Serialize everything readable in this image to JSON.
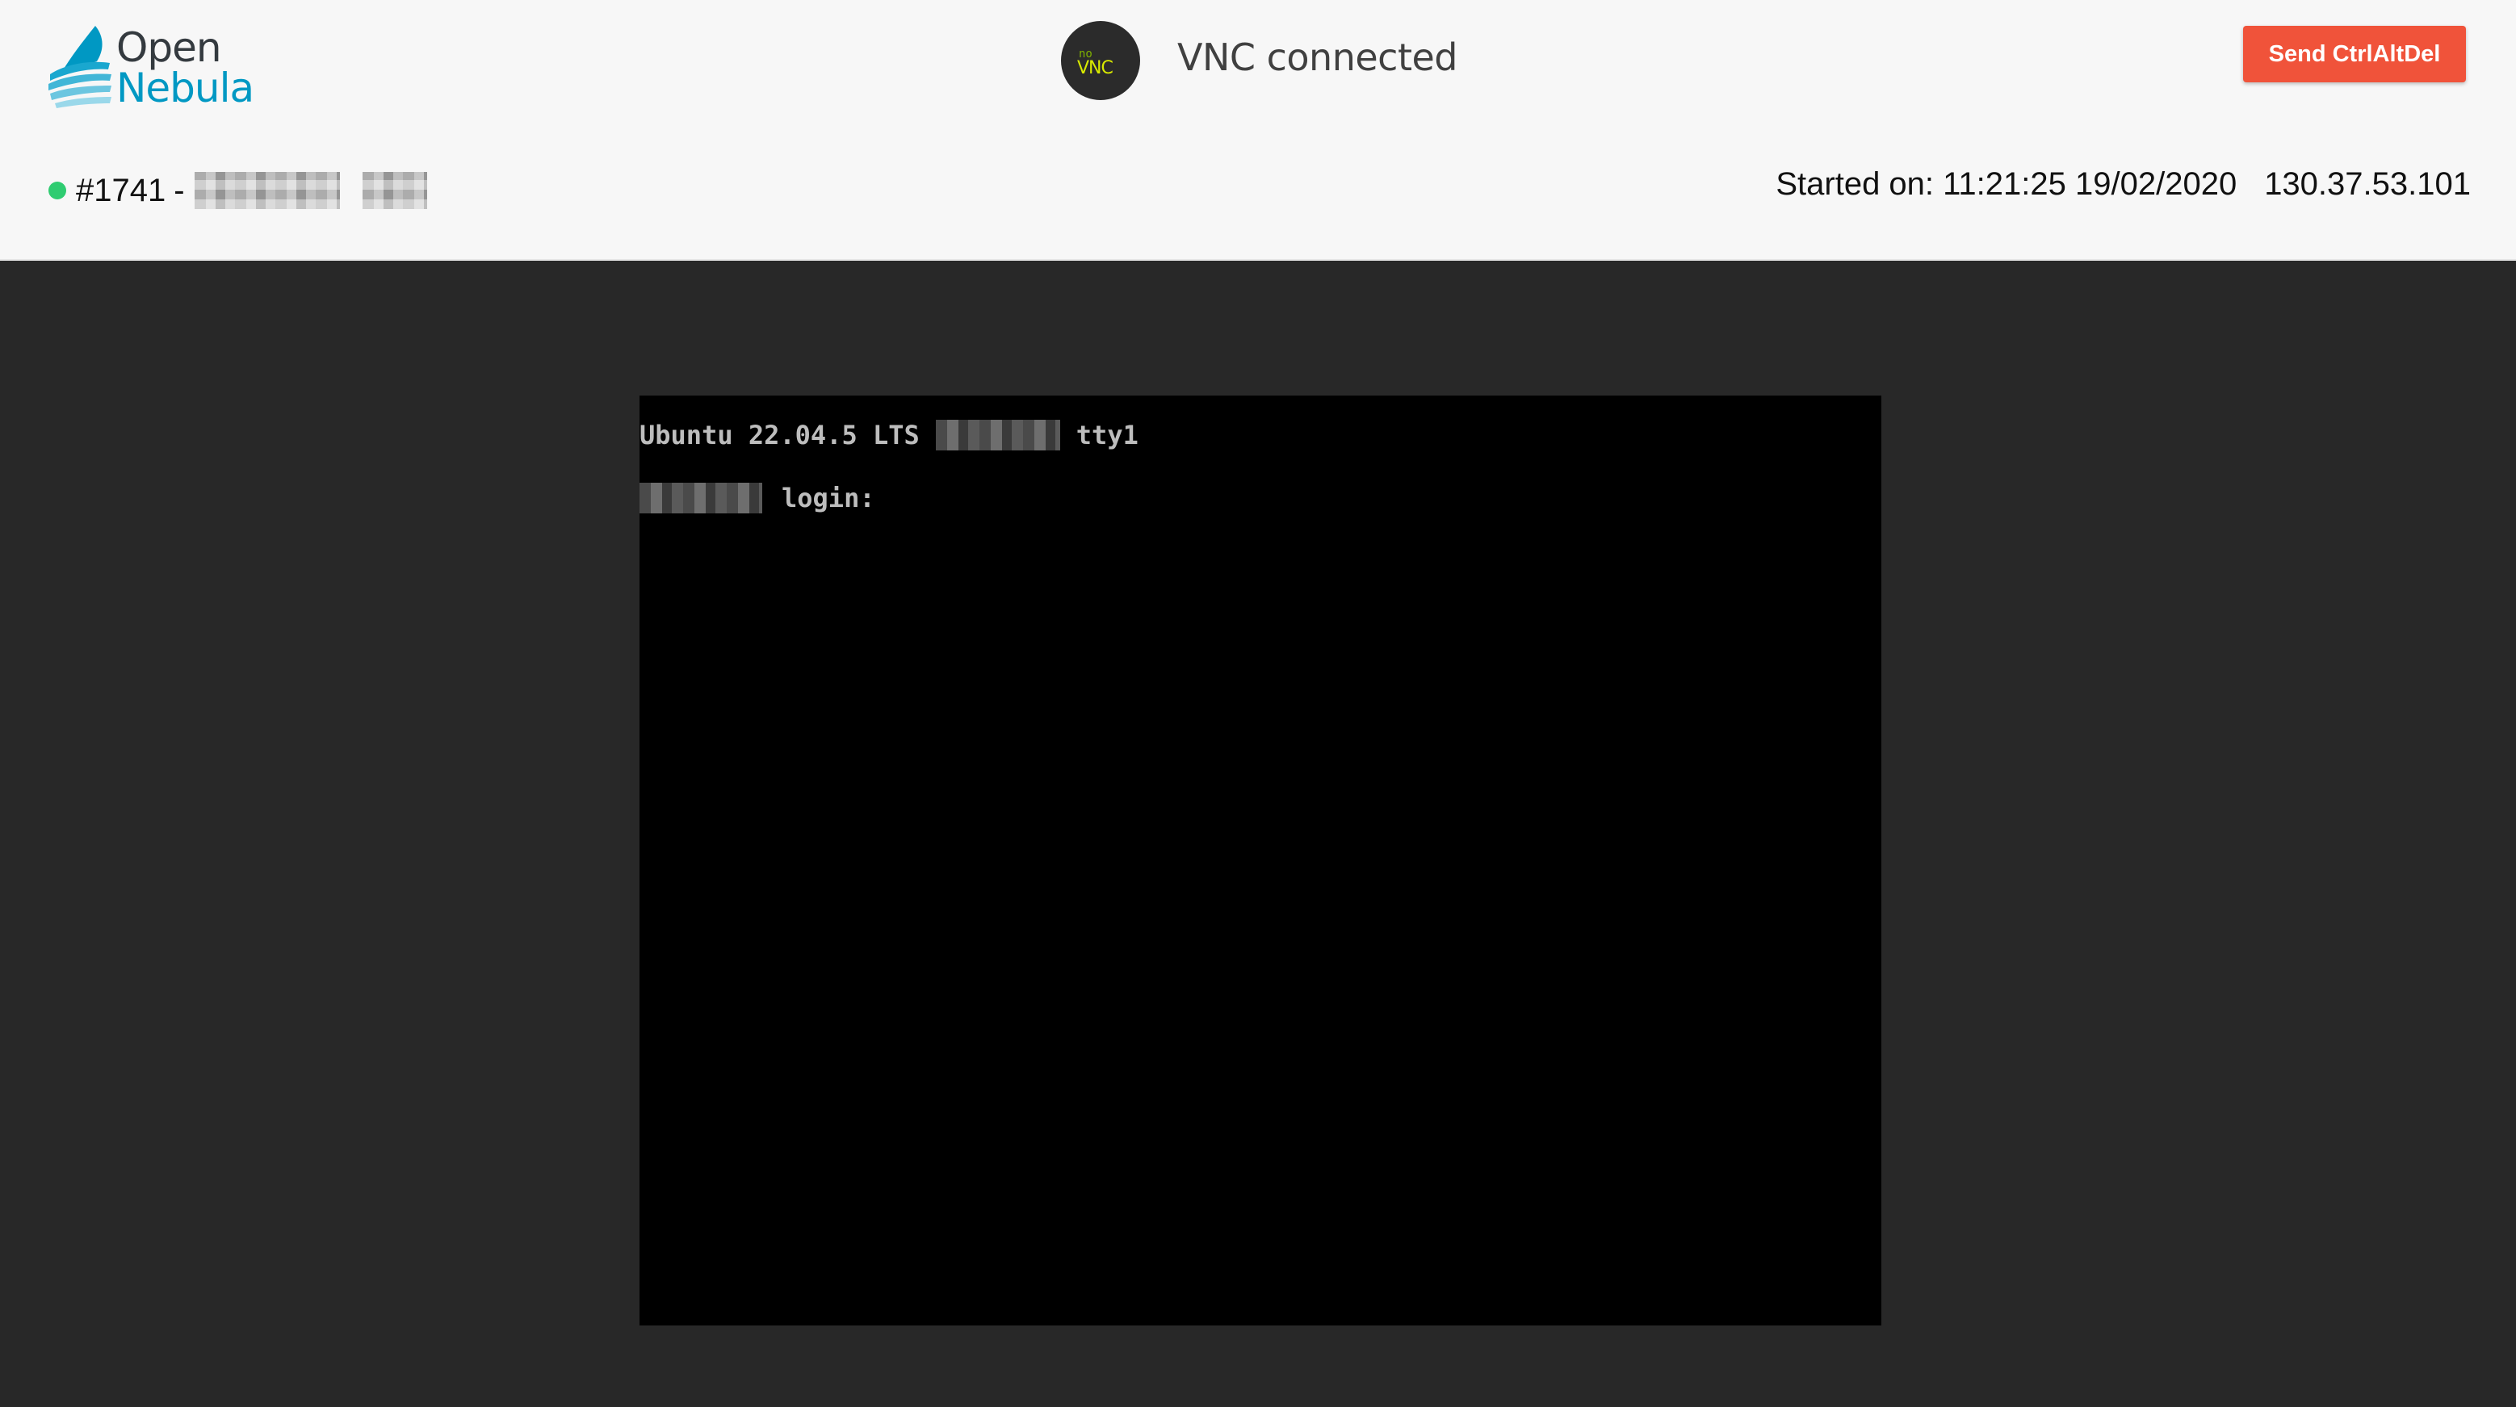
{
  "logo": {
    "line1": "Open",
    "line2": "Nebula"
  },
  "novnc": {
    "logo_small": "no",
    "logo_large": "VNC",
    "status": "VNC connected"
  },
  "toolbar": {
    "ctrl_alt_del_label": "Send CtrlAltDel"
  },
  "vm": {
    "id": "#1741",
    "separator": "-",
    "status_color": "#2fcc71",
    "started_on": "Started on: 11:21:25 19/02/2020",
    "ip": "130.37.53.101"
  },
  "console": {
    "line1_prefix": "Ubuntu 22.04.5 LTS",
    "line1_suffix": "tty1",
    "line2_suffix": "login:"
  },
  "colors": {
    "brand_blue": "#0098c3",
    "button_red": "#f0533a",
    "background_dark": "#282828"
  }
}
